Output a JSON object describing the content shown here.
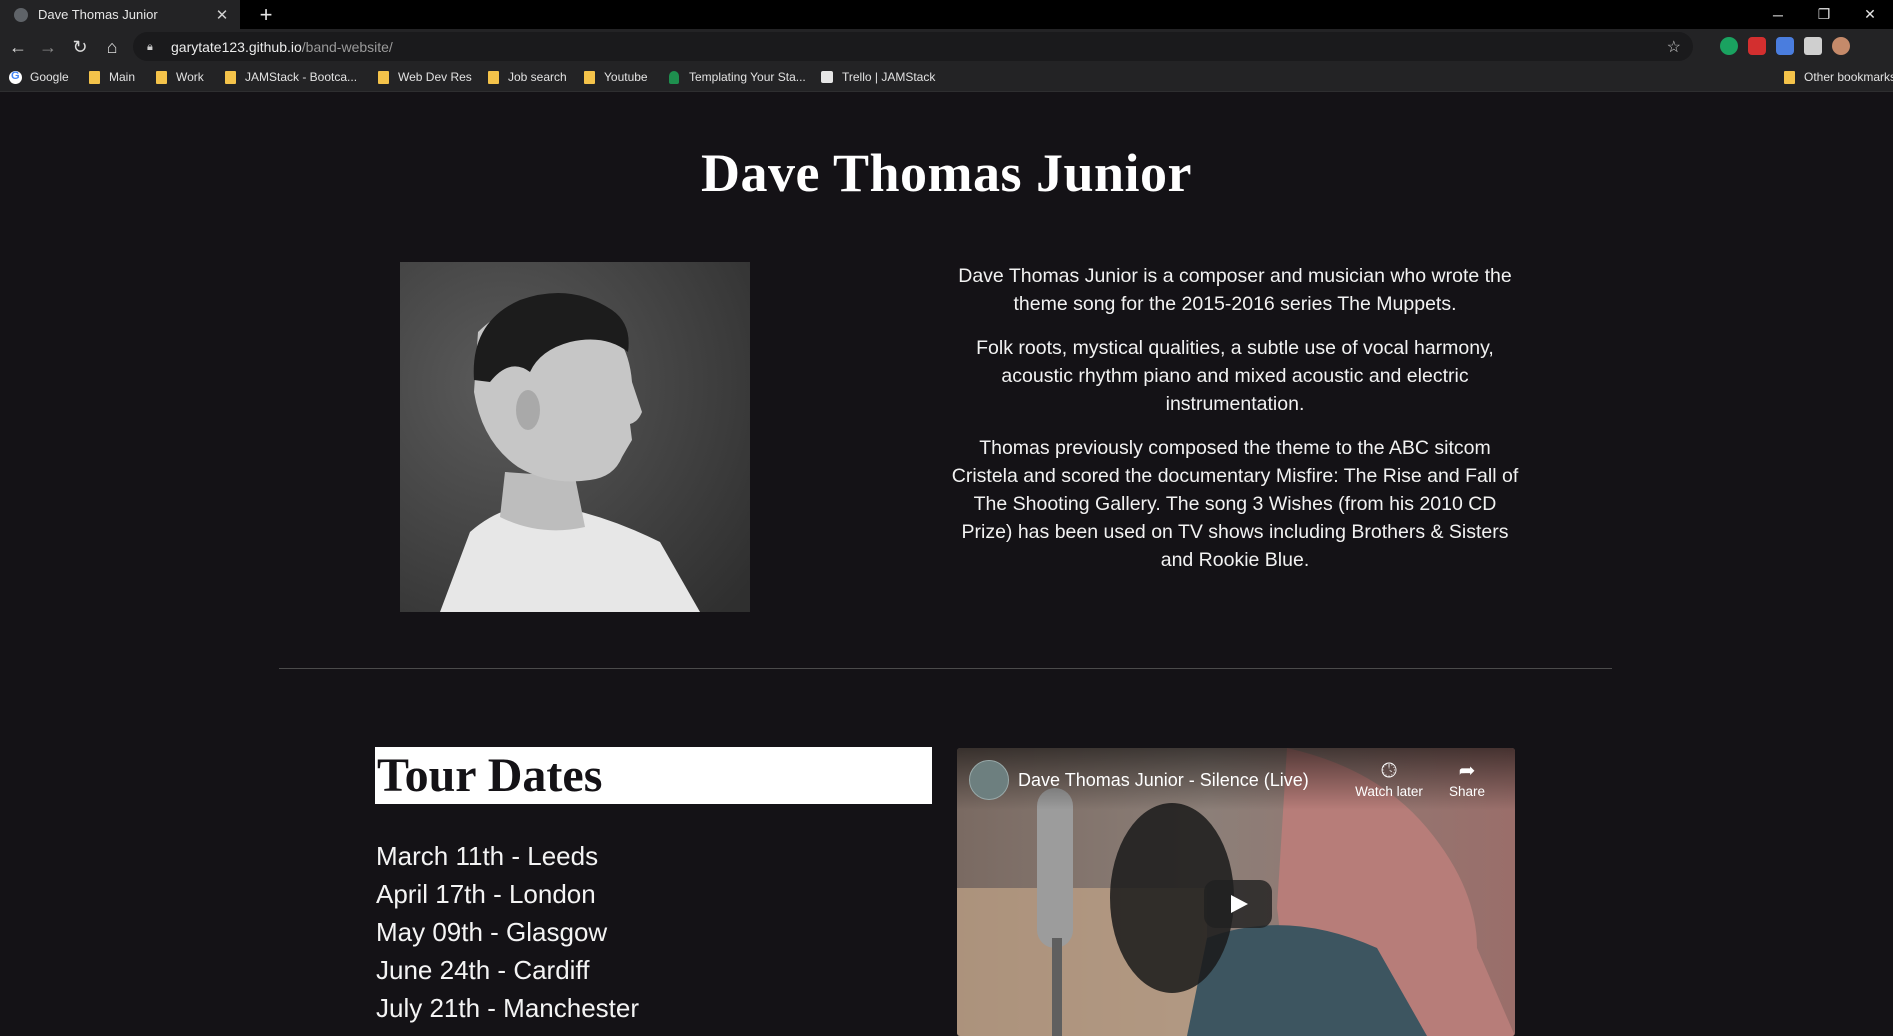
{
  "browser": {
    "tab": {
      "title": "Dave Thomas Junior",
      "close": "✕"
    },
    "new_tab": "+",
    "window_controls": {
      "minimize": "─",
      "restore": "❐",
      "close": "✕"
    },
    "nav": {
      "back": "←",
      "forward": "→",
      "reload": "↻",
      "home": "⌂"
    },
    "url": {
      "host": "garytate123.github.io",
      "path": "/band-website/"
    },
    "bookmark_star": "☆",
    "bookmarks": [
      {
        "label": "Google",
        "icon": "google-icon"
      },
      {
        "label": "Main",
        "icon": "folder-icon"
      },
      {
        "label": "Work",
        "icon": "folder-icon"
      },
      {
        "label": "JAMStack - Bootca...",
        "icon": "folder-icon"
      },
      {
        "label": "Web Dev Res",
        "icon": "folder-icon"
      },
      {
        "label": "Job search",
        "icon": "folder-icon"
      },
      {
        "label": "Youtube",
        "icon": "folder-icon"
      },
      {
        "label": "Templating Your Sta...",
        "icon": "page-icon"
      },
      {
        "label": "Trello | JAMStack",
        "icon": "trello-icon"
      },
      {
        "label": "Other bookmarks",
        "icon": "folder-icon"
      }
    ],
    "extension_colors": [
      "#1aa260",
      "#d32f2f",
      "#4a7dde",
      "#cfcfcf",
      "#c58a6a"
    ]
  },
  "site": {
    "title": "Dave Thomas Junior",
    "bio": [
      "Dave Thomas Junior is a composer and musician who wrote the theme song for the 2015-2016 series The Muppets.",
      "Folk roots, mystical qualities, a subtle use of vocal harmony, acoustic rhythm piano and mixed acoustic and electric instrumentation.",
      "Thomas previously composed the theme to the ABC sitcom Cristela and scored the documentary Misfire: The Rise and Fall of The Shooting Gallery. The song 3 Wishes (from his 2010 CD Prize) has been used on TV shows including Brothers & Sisters and Rookie Blue."
    ],
    "tour": {
      "heading": "Tour Dates",
      "dates": [
        "March 11th - Leeds",
        "April 17th - London",
        "May 09th - Glasgow",
        "June 24th - Cardiff",
        "July 21th - Manchester"
      ]
    },
    "video": {
      "title": "Dave Thomas Junior - Silence (Live)",
      "watch_later": "Watch later",
      "share": "Share"
    }
  }
}
